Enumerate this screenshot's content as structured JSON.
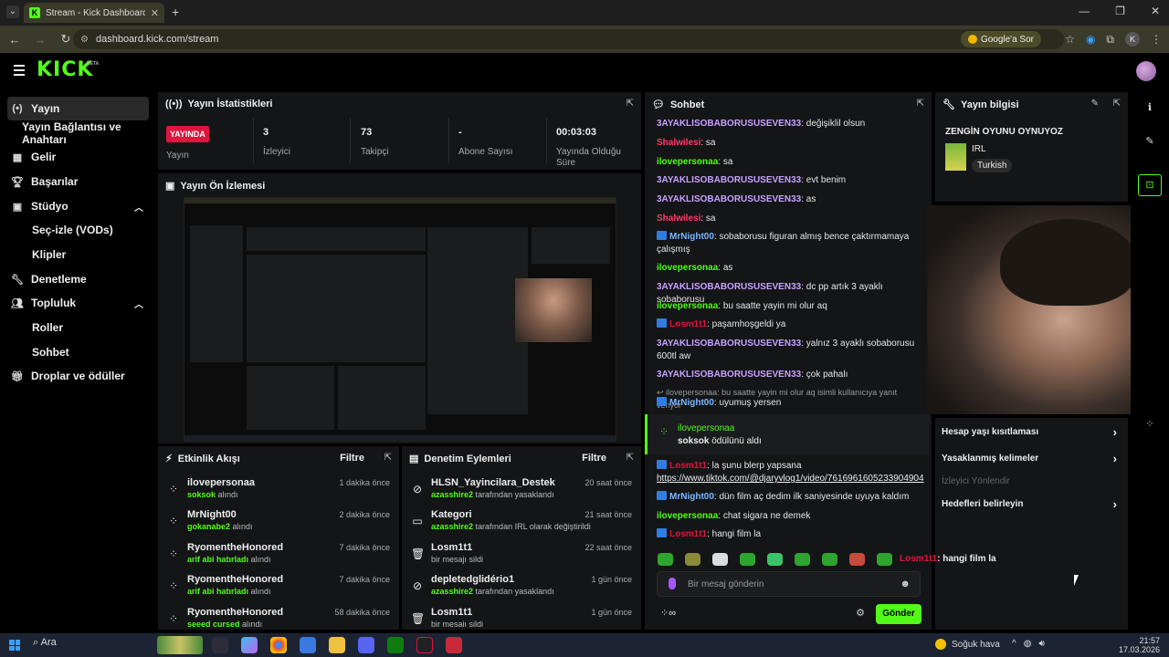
{
  "browser": {
    "tab_title": "Stream - Kick Dashboard",
    "url": "dashboard.kick.com/stream",
    "google_button": "Google'a Sor",
    "profile_initial": "K"
  },
  "header": {
    "logo": "KICK",
    "beta": "BETA"
  },
  "sidebar": {
    "items": [
      {
        "label": "Yayın",
        "icon": "broadcast-icon"
      },
      {
        "label": "Yayın Bağlantısı ve Anahtarı",
        "icon": ""
      },
      {
        "label": "Gelir",
        "icon": "revenue-icon"
      },
      {
        "label": "Başarılar",
        "icon": "trophy-icon"
      },
      {
        "label": "Stüdyo",
        "icon": "studio-icon"
      },
      {
        "label": "Seç-izle (VODs)",
        "icon": ""
      },
      {
        "label": "Klipler",
        "icon": ""
      },
      {
        "label": "Denetleme",
        "icon": "wrench-icon"
      },
      {
        "label": "Topluluk",
        "icon": "community-icon"
      },
      {
        "label": "Roller",
        "icon": ""
      },
      {
        "label": "Sohbet",
        "icon": ""
      },
      {
        "label": "Droplar ve ödüller",
        "icon": "gift-icon"
      }
    ]
  },
  "stats": {
    "title": "Yayın İstatistikleri",
    "live_badge": "YAYINDA",
    "live_label": "Yayın",
    "viewers_value": "3",
    "viewers_label": "İzleyici",
    "followers_value": "73",
    "followers_label": "Takipçi",
    "subs_value": "-",
    "subs_label": "Abone Sayısı",
    "duration_value": "00:03:03",
    "duration_label": "Yayında Olduğu Süre"
  },
  "preview": {
    "title": "Yayın Ön İzlemesi"
  },
  "events": {
    "title": "Etkinlik Akışı",
    "filter": "Filtre",
    "rows": [
      {
        "name": "ilovepersonaa",
        "reward": "soksok",
        "suffix": " alındı",
        "time": "1 dakika önce"
      },
      {
        "name": "MrNight00",
        "reward": "gokanabe2",
        "suffix": " alındı",
        "time": "2 dakika önce"
      },
      {
        "name": "RyomentheHonored",
        "reward": "arif abi hatırladı",
        "suffix": " alındı",
        "time": "7 dakika önce"
      },
      {
        "name": "RyomentheHonored",
        "reward": "arif abi hatırladı",
        "suffix": " alındı",
        "time": "7 dakika önce"
      },
      {
        "name": "RyomentheHonored",
        "reward": "seeed cursed",
        "suffix": " alındı",
        "time": "58 dakika önce"
      }
    ]
  },
  "moderation": {
    "title": "Denetim Eylemleri",
    "filter": "Filtre",
    "rows": [
      {
        "name": "HLSN_Yayincilara_Destek",
        "who": "azasshire2",
        "detail": " tarafından yasaklandı",
        "time": "20 saat önce"
      },
      {
        "name": "Kategori",
        "who": "azasshire2",
        "detail": " tarafından IRL olarak değiştirildi",
        "time": "21 saat önce"
      },
      {
        "name": "Losm1t1",
        "who": "",
        "detail": "bir mesajı sildi",
        "time": "22 saat önce"
      },
      {
        "name": "depletedglidério1",
        "who": "azasshire2",
        "detail": " tarafından yasaklandı",
        "time": "1 gün önce"
      },
      {
        "name": "Losm1t1",
        "who": "",
        "detail": "bir mesajı sildi",
        "time": "1 gün önce"
      }
    ]
  },
  "chat": {
    "title": "Sohbet",
    "messages": [
      {
        "user": "3AYAKLISOBABORUSUSEVEN33",
        "color": "u-p",
        "text": ": değişiklil olsun"
      },
      {
        "user": "Shalwilesi",
        "color": "u-r",
        "text": ": sa"
      },
      {
        "user": "ilovepersonaa",
        "color": "u-g",
        "text": ": sa"
      },
      {
        "user": "3AYAKLISOBABORUSUSEVEN33",
        "color": "u-p",
        "text": ": evt benim"
      },
      {
        "user": "3AYAKLISOBABORUSUSEVEN33",
        "color": "u-p",
        "text": ": as"
      },
      {
        "user": "Shalwilesi",
        "color": "u-r",
        "text": ": sa"
      },
      {
        "user": "MrNight00",
        "color": "u-b",
        "text": ": sobaborusu figuran almış bence çaktırmamaya çalışmış"
      },
      {
        "user": "ilovepersonaa",
        "color": "u-g",
        "text": ": as"
      },
      {
        "user": "3AYAKLISOBABORUSUSEVEN33",
        "color": "u-p",
        "text": ": dc pp artık 3 ayaklı sobaborusu"
      },
      {
        "user": "ilovepersonaa",
        "color": "u-g",
        "text": ": bu saatte yayin mi olur aq"
      },
      {
        "user": "Losm1t1",
        "color": "u-red",
        "text": ": paşamhoşgeldi ya"
      },
      {
        "user": "3AYAKLISOBABORUSUSEVEN33",
        "color": "u-p",
        "text": ": yalnız 3 ayaklı sobaborusu 600tl aw"
      },
      {
        "user": "3AYAKLISOBABORUSUSEVEN33",
        "color": "u-p",
        "text": ": çok pahalı"
      }
    ],
    "reply_line": "↩ ilovepersonaa: bu saatte yayin mi olur aq isimli kullanıcıya yanıt veriyor",
    "reply_msg": {
      "user": "MrNight00",
      "text": ": uyumuş yersen"
    },
    "reward": {
      "user": "ilovepersonaa",
      "item": "soksok",
      "text": " ödülünü aldı"
    },
    "after": [
      {
        "user": "Losm1t1",
        "color": "u-red",
        "text": ": la şunu blerp yapsana"
      },
      {
        "user": "MrNight00",
        "color": "u-b",
        "text": ": dün film aç dedim ilk saniyesinde uyuya kaldım"
      },
      {
        "user": "ilovepersonaa",
        "color": "u-g",
        "text": ": chat sigara ne demek"
      },
      {
        "user": "Losm1t1",
        "color": "u-red",
        "text": ": hangi film la"
      }
    ],
    "link": "https://www.tiktok.com/@djaryvlog1/video/7616961605233904904",
    "input_placeholder": "Bir mesaj gönderin",
    "send": "Gönder"
  },
  "info": {
    "title": "Yayın bilgisi",
    "stream_name": "ZENGİN OYUNU OYNUYOZ",
    "category": "IRL",
    "tag": "Turkish"
  },
  "actions": {
    "items": [
      {
        "label": "Hesap yaşı kısıtlaması",
        "chevron": "›",
        "dim": false
      },
      {
        "label": "Yasaklanmış kelimeler",
        "chevron": "›",
        "dim": false
      },
      {
        "label": "İzleyici Yönlendir",
        "chevron": "",
        "dim": true
      },
      {
        "label": "Hedefleri belirleyin",
        "chevron": "›",
        "dim": false
      }
    ]
  },
  "overlay": {
    "user": "Losm1t1",
    "text": ": hangi film la"
  },
  "taskbar": {
    "search": "Ara",
    "weather": "Soğuk hava",
    "time": "21:57",
    "date": "17.03.2026"
  },
  "colors": {
    "accent": "#53fc18",
    "live": "#e0143c",
    "panel": "#141517"
  }
}
